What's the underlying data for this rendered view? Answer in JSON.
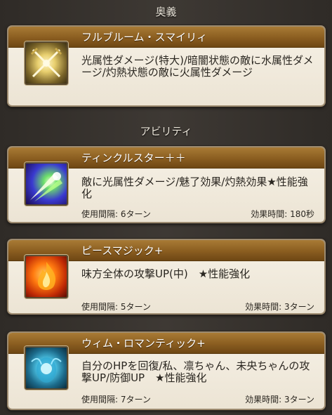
{
  "sections": {
    "ougi_title": "奥義",
    "ability_title": "アビリティ"
  },
  "ougi": {
    "name": "フルブルーム・スマイリィ",
    "icon": "crossed-swords-icon",
    "description": "光属性ダメージ(特大)/暗闇状態の敵に水属性ダメージ/灼熱状態の敵に火属性ダメージ"
  },
  "abilities": [
    {
      "name": "ティンクルスター＋＋",
      "icon": "light-burst-icon",
      "description": "敵に光属性ダメージ/魅了効果/灼熱効果★性能強化",
      "cooldown": "使用間隔: 6ターン",
      "duration": "効果時間: 180秒"
    },
    {
      "name": "ピースマジック+",
      "icon": "flame-icon",
      "description": "味方全体の攻撃UP(中)　★性能強化",
      "cooldown": "使用間隔: 5ターン",
      "duration": "効果時間: 3ターン"
    },
    {
      "name": "ウィム・ロマンティック+",
      "icon": "heal-aura-icon",
      "description": "自分のHPを回復/私、凛ちゃん、未央ちゃんの攻撃UP/防御UP　★性能強化",
      "cooldown": "使用間隔: 7ターン",
      "duration": "効果時間: 3ターン"
    }
  ]
}
